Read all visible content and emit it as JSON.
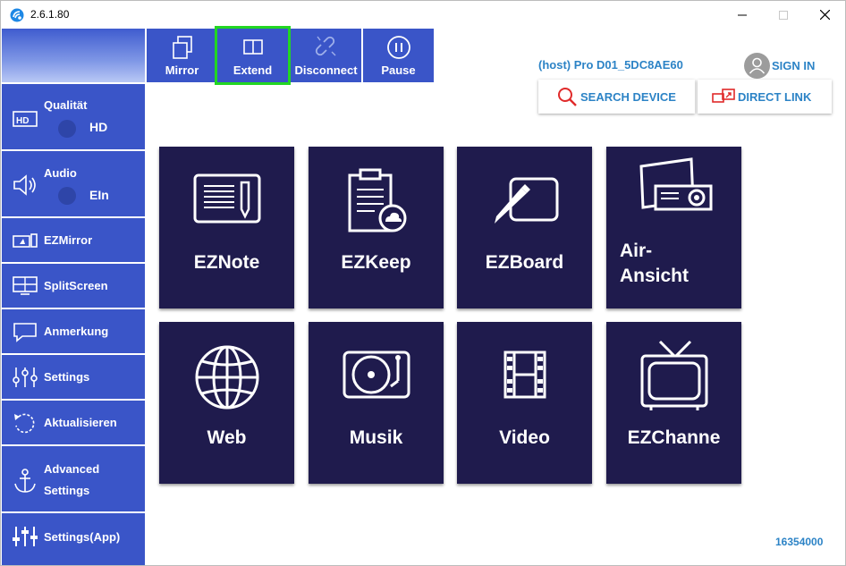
{
  "window": {
    "title": "2.6.1.80"
  },
  "toolbar": {
    "items": [
      {
        "label": "Mirror",
        "icon": "mirror-icon"
      },
      {
        "label": "Extend",
        "icon": "extend-icon",
        "selected": true
      },
      {
        "label": "Disconnect",
        "icon": "disconnect-icon"
      },
      {
        "label": "Pause",
        "icon": "pause-icon"
      }
    ]
  },
  "sidebar": {
    "items": [
      {
        "label": "Qualität",
        "value": "HD",
        "icon": "hd-icon"
      },
      {
        "label": "Audio",
        "value": "EIn",
        "icon": "speaker-icon"
      },
      {
        "label": "EZMirror",
        "icon": "ezmirror-icon"
      },
      {
        "label": "SplitScreen",
        "icon": "splitscreen-icon"
      },
      {
        "label": "Anmerkung",
        "icon": "comment-icon"
      },
      {
        "label": "Settings",
        "icon": "sliders-icon"
      },
      {
        "label": "Aktualisieren",
        "icon": "refresh-icon"
      },
      {
        "label": "Advanced",
        "label2": "Settings",
        "icon": "anchor-icon"
      },
      {
        "label": "Settings(App)",
        "icon": "equalizer-icon"
      }
    ]
  },
  "header": {
    "host": "(host) Pro D01_5DC8AE60",
    "sign_in": "SIGN IN",
    "search_device": "SEARCH DEVICE",
    "direct_link": "DIRECT LINK"
  },
  "tiles": [
    {
      "label": "EZNote",
      "icon": "notepad-pen-icon"
    },
    {
      "label": "EZKeep",
      "icon": "clipboard-cloud-icon"
    },
    {
      "label": "EZBoard",
      "icon": "whiteboard-pen-icon"
    },
    {
      "label": "Air-\nAnsicht",
      "label_line1": "Air-",
      "label_line2": "Ansicht",
      "icon": "projector-icon"
    },
    {
      "label": "Web",
      "icon": "globe-icon"
    },
    {
      "label": "Musik",
      "icon": "turntable-icon"
    },
    {
      "label": "Video",
      "icon": "film-icon"
    },
    {
      "label": "EZChanne",
      "icon": "tv-icon"
    }
  ],
  "footer": {
    "code": "16354000"
  },
  "colors": {
    "sidebar": "#3a55c8",
    "tile": "#1f1b4d",
    "accent_text": "#2c83c6",
    "selected_outline": "#22d622"
  }
}
